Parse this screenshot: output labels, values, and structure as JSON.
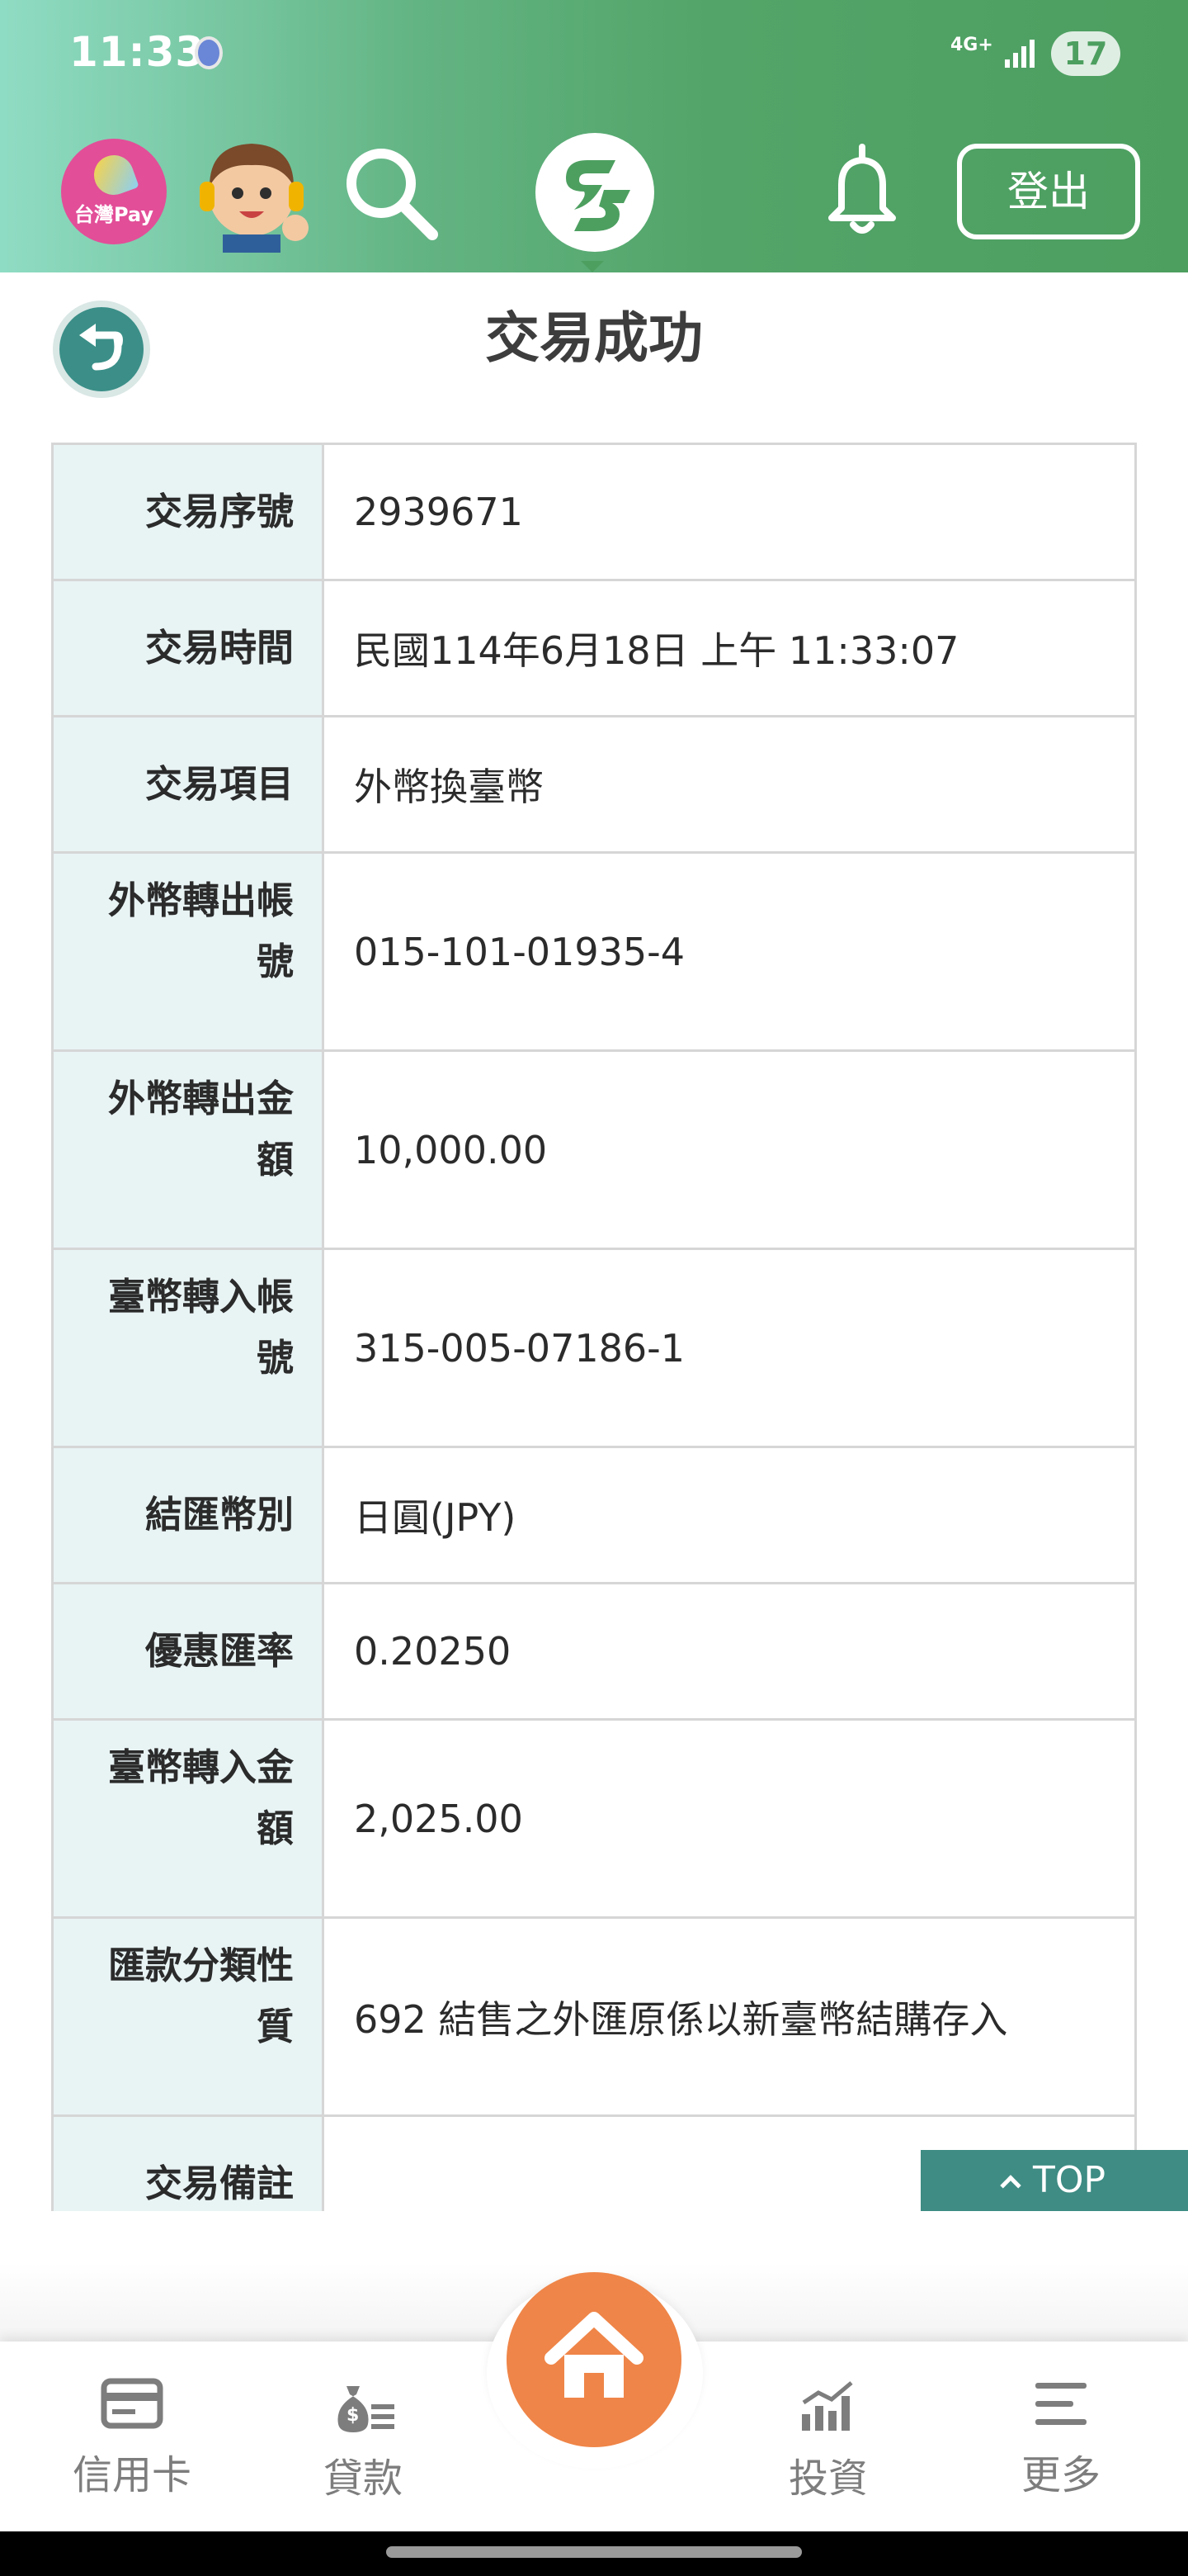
{
  "status_bar": {
    "time": "11:33",
    "network": "4G+",
    "battery": "17"
  },
  "header": {
    "taiwan_pay_label": "台灣Pay",
    "logout_label": "登出"
  },
  "page": {
    "title": "交易成功"
  },
  "details": [
    {
      "label": "交易序號",
      "value": "2939671"
    },
    {
      "label": "交易時間",
      "value": "民國114年6月18日 上午 11:33:07"
    },
    {
      "label": "交易項目",
      "value": "外幣換臺幣"
    },
    {
      "label": "外幣轉出帳號",
      "value": "015-101-01935-4"
    },
    {
      "label": "外幣轉出金額",
      "value": "10,000.00"
    },
    {
      "label": "臺幣轉入帳號",
      "value": "315-005-07186-1"
    },
    {
      "label": "結匯幣別",
      "value": "日圓(JPY)"
    },
    {
      "label": "優惠匯率",
      "value": "0.20250"
    },
    {
      "label": "臺幣轉入金額",
      "value": "2,025.00"
    },
    {
      "label": "匯款分類性質",
      "value": "692 結售之外匯原係以新臺幣結購存入"
    },
    {
      "label": "交易備註",
      "value": ""
    }
  ],
  "top_button": "TOP",
  "bottom_nav": {
    "credit_card": "信用卡",
    "loan": "貸款",
    "invest": "投資",
    "more": "更多"
  },
  "colors": {
    "header_green": "#4d9f60",
    "accent_teal": "#3e8c84",
    "home_orange": "#ef8548",
    "label_bg": "#e8f3f4"
  }
}
